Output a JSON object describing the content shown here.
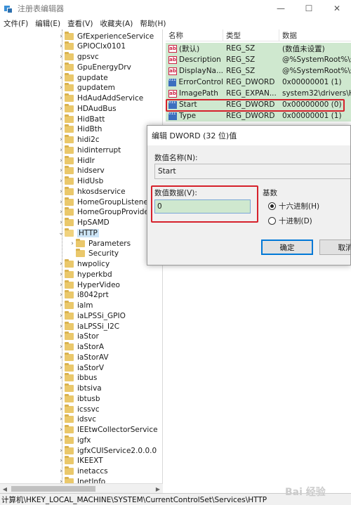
{
  "window": {
    "title": "注册表编辑器",
    "min": "—",
    "max": "☐",
    "close": "✕"
  },
  "menu": [
    "文件(F)",
    "编辑(E)",
    "查看(V)",
    "收藏夹(A)",
    "帮助(H)"
  ],
  "tree": {
    "items": [
      "GfExperienceService",
      "GPIOClx0101",
      "gpsvc",
      "GpuEnergyDrv",
      "gupdate",
      "gupdatem",
      "HdAudAddService",
      "HDAudBus",
      "HidBatt",
      "HidBth",
      "hidi2c",
      "hidinterrupt",
      "HidIr",
      "hidserv",
      "HidUsb",
      "hkosdservice",
      "HomeGroupListener",
      "HomeGroupProvider",
      "HpSAMD",
      "HTTP",
      "Parameters",
      "Security",
      "hwpolicy",
      "hyperkbd",
      "HyperVideo",
      "i8042prt",
      "ialm",
      "iaLPSSi_GPIO",
      "iaLPSSi_I2C",
      "iaStor",
      "iaStorA",
      "iaStorAV",
      "iaStorV",
      "ibbus",
      "ibtsiva",
      "ibtusb",
      "icssvc",
      "idsvc",
      "IEEtwCollectorService",
      "igfx",
      "igfxCUIService2.0.0.0",
      "IKEEXT",
      "inetaccs",
      "InetInfo"
    ]
  },
  "list": {
    "headers": [
      "名称",
      "类型",
      "数据"
    ],
    "rows": [
      {
        "icon": "ab",
        "name": "(默认)",
        "type": "REG_SZ",
        "data": "(数值未设置)"
      },
      {
        "icon": "ab",
        "name": "Description",
        "type": "REG_SZ",
        "data": "@%SystemRoot%\\s"
      },
      {
        "icon": "ab",
        "name": "DisplayNa...",
        "type": "REG_SZ",
        "data": "@%SystemRoot%\\s"
      },
      {
        "icon": "bin",
        "name": "ErrorControl",
        "type": "REG_DWORD",
        "data": "0x00000001 (1)"
      },
      {
        "icon": "ab",
        "name": "ImagePath",
        "type": "REG_EXPAN...",
        "data": "system32\\drivers\\H"
      },
      {
        "icon": "bin",
        "name": "Start",
        "type": "REG_DWORD",
        "data": "0x00000000 (0)"
      },
      {
        "icon": "bin",
        "name": "Type",
        "type": "REG_DWORD",
        "data": "0x00000001 (1)"
      }
    ]
  },
  "dialog": {
    "title": "编辑 DWORD (32 位)值",
    "name_label": "数值名称(N):",
    "name_value": "Start",
    "data_label": "数值数据(V):",
    "data_value": "0",
    "base_label": "基数",
    "hex_label": "十六进制(H)",
    "dec_label": "十进制(D)",
    "ok": "确定",
    "cancel": "取消"
  },
  "status": "计算机\\HKEY_LOCAL_MACHINE\\SYSTEM\\CurrentControlSet\\Services\\HTTP",
  "watermark": "Bai 经验",
  "colors": {
    "highlight_red": "#d6212b",
    "row_green": "#cfe8cf",
    "accent_blue": "#0078d7"
  }
}
